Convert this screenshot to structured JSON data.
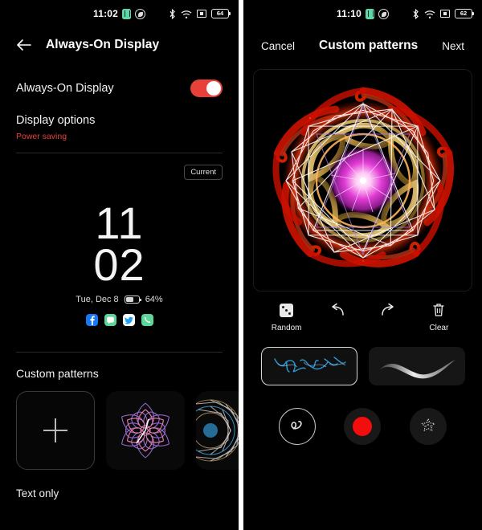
{
  "left_screen": {
    "status_bar": {
      "time": "11:02",
      "icons": [
        "sim-card-icon",
        "phone-call-icon",
        "bluetooth-icon",
        "wifi-icon",
        "screencast-icon"
      ],
      "battery_level": "64"
    },
    "app_bar": {
      "back_icon": "back-arrow-icon",
      "title": "Always-On Display"
    },
    "toggle_row": {
      "label": "Always-On Display",
      "state": "on",
      "accent_color": "#e8413a"
    },
    "display_options": {
      "title": "Display options",
      "value": "Power saving",
      "value_color": "#e8413a"
    },
    "preview": {
      "badge": "Current",
      "clock_hours": "11",
      "clock_minutes": "02",
      "date": "Tue, Dec 8",
      "battery_percent": "64%",
      "app_icons": [
        {
          "name": "facebook-icon",
          "color": "#1877f2"
        },
        {
          "name": "messages-icon",
          "color": "#5ed69a"
        },
        {
          "name": "twitter-icon",
          "color": "#1da1f2"
        },
        {
          "name": "phone-icon",
          "color": "#5ed69a"
        }
      ]
    },
    "custom_patterns": {
      "title": "Custom patterns",
      "thumbnails": [
        {
          "name": "add-pattern-thumbnail",
          "type": "add",
          "label": "+"
        },
        {
          "name": "pattern-thumbnail-purple",
          "type": "pattern"
        },
        {
          "name": "pattern-thumbnail-blue",
          "type": "pattern"
        }
      ]
    },
    "footer": {
      "label": "Text only"
    }
  },
  "right_screen": {
    "status_bar": {
      "time": "11:10",
      "icons": [
        "sim-card-icon",
        "phone-call-icon",
        "bluetooth-icon",
        "wifi-icon",
        "screencast-icon"
      ],
      "battery_level": "62"
    },
    "action_bar": {
      "cancel": "Cancel",
      "title": "Custom patterns",
      "next": "Next"
    },
    "canvas": {
      "name": "pattern-canvas",
      "description": "mandala pattern"
    },
    "tools": [
      {
        "name": "random-tool",
        "icon": "dice-icon",
        "label": "Random"
      },
      {
        "name": "undo-tool",
        "icon": "undo-icon",
        "label": ""
      },
      {
        "name": "redo-tool",
        "icon": "redo-icon",
        "label": ""
      },
      {
        "name": "clear-tool",
        "icon": "trash-icon",
        "label": "Clear"
      }
    ],
    "brushes": [
      {
        "name": "brush-style-wisp",
        "selected": true
      },
      {
        "name": "brush-style-ribbon",
        "selected": false
      }
    ],
    "bottom_controls": [
      {
        "name": "stroke-style-button",
        "icon": "squiggle-icon"
      },
      {
        "name": "color-picker-button",
        "icon": "color-dot",
        "color": "#f40d0d"
      },
      {
        "name": "effects-button",
        "icon": "sparkle-star-icon"
      }
    ]
  }
}
